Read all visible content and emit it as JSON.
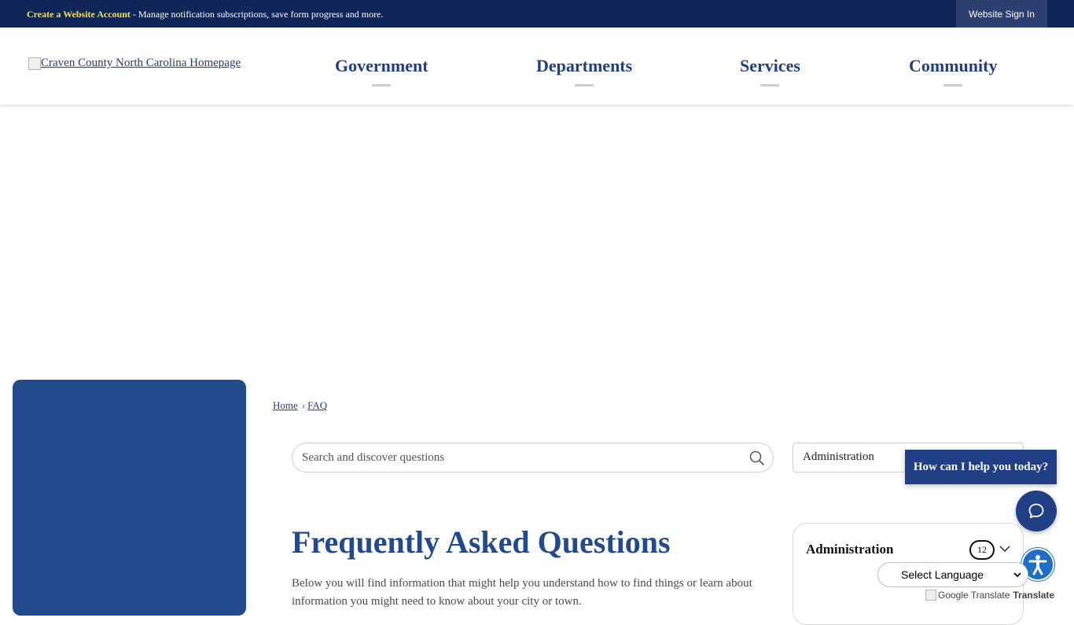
{
  "topbar": {
    "promo_link": "Create a Website Account",
    "promo_text": " - Manage notification subscriptions, save form progress and more.",
    "signin_label": "Website Sign In"
  },
  "header": {
    "logo_alt": "Craven County North Carolina Homepage",
    "nav": [
      {
        "label": "Government"
      },
      {
        "label": "Departments"
      },
      {
        "label": "Services"
      },
      {
        "label": "Community"
      }
    ]
  },
  "breadcrumb": {
    "home": "Home",
    "separator": "›",
    "current": "FAQ"
  },
  "search": {
    "placeholder": "Search and discover questions",
    "icon": "search-icon"
  },
  "category_filter": {
    "selected": "Administration"
  },
  "main": {
    "title": "Frequently Asked Questions",
    "intro": "Below you will find information that might help you understand how to find things or learn about information you might need to know about your city or town."
  },
  "category_card": {
    "title": "Administration",
    "count": "12",
    "icon": "chevron-down-icon"
  },
  "chat": {
    "prompt": "How can I help you today?",
    "icon": "chat-icon"
  },
  "accessibility": {
    "icon": "accessibility-icon"
  },
  "translate": {
    "select_label": "Select Language",
    "credit_alt": "Google Translate",
    "credit_text": "Translate"
  },
  "colors": {
    "topbar_bg": "#102558",
    "accent_blue": "#244a8e",
    "nav_text": "#213f85",
    "promo_link": "#f3e03f",
    "accessibility_blue": "#1f6ec1"
  }
}
